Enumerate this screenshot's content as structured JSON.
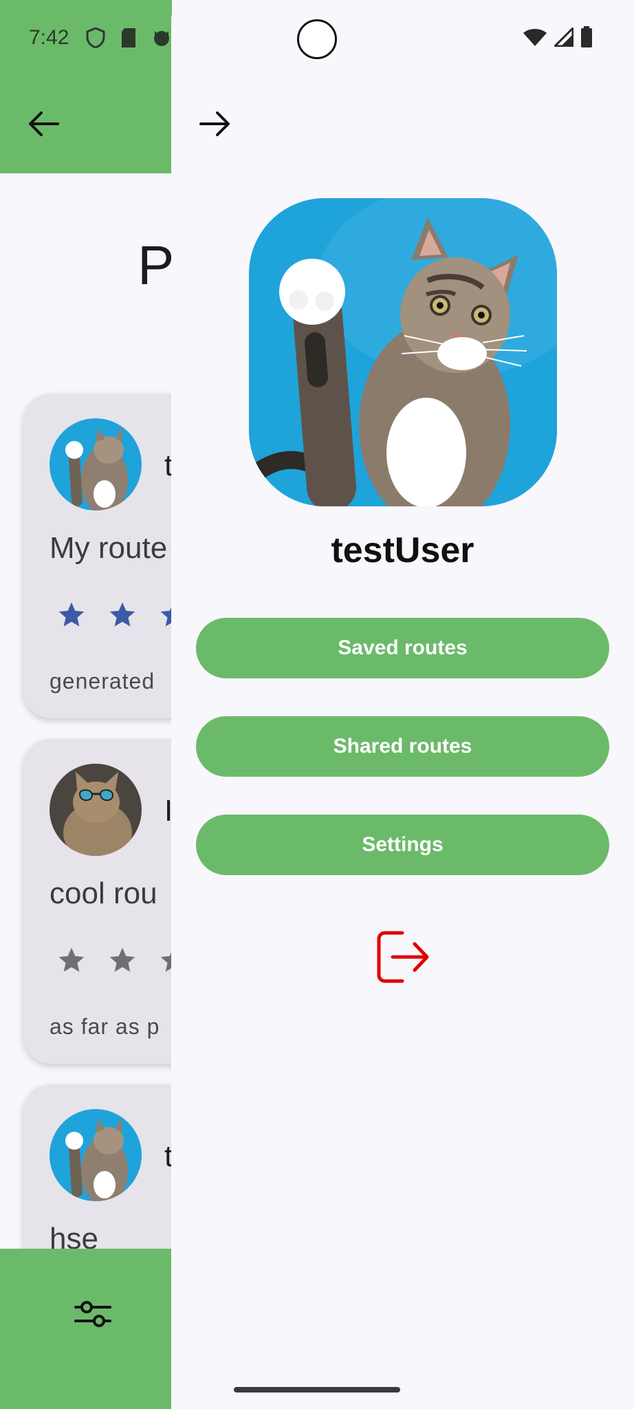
{
  "status_bar": {
    "time": "7:42"
  },
  "background_screen": {
    "title_fragment": "P",
    "cards": [
      {
        "author_fragment": "t",
        "title_fragment": "My route",
        "description_fragment": "generated",
        "star_color": "#3B5BA5"
      },
      {
        "author_fragment": "I",
        "title_fragment": "cool rou",
        "description_fragment": "as far as p",
        "star_color": "#6F6E75"
      },
      {
        "author_fragment": "t",
        "title_fragment": "hse",
        "description_fragment": "",
        "star_color": "#6F6E75"
      }
    ]
  },
  "drawer": {
    "username": "testUser",
    "menu": [
      {
        "label": "Saved routes"
      },
      {
        "label": "Shared routes"
      },
      {
        "label": "Settings"
      }
    ],
    "logout_icon": "logout-icon"
  },
  "colors": {
    "accent_green": "#6BBA6A",
    "logout_red": "#E00000",
    "background": "#F8F7FC"
  }
}
